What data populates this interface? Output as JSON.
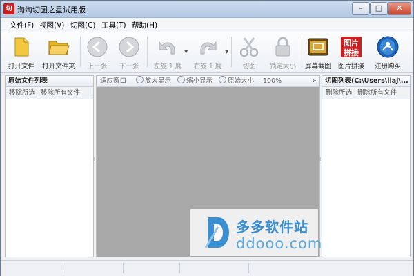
{
  "window": {
    "title": "淘淘切图之星试用版",
    "icon_name": "app-icon",
    "controls": [
      {
        "name": "minimize-button",
        "glyph": "–"
      },
      {
        "name": "maximize-button",
        "glyph": "□"
      },
      {
        "name": "close-button",
        "glyph": "✕"
      }
    ]
  },
  "menu": [
    "文件(F)",
    "视图(V)",
    "切图(C)",
    "工具(T)",
    "帮助(H)"
  ],
  "toolbar": [
    {
      "label": "打开文件",
      "icon": "open-file-icon",
      "enabled": true
    },
    {
      "label": "打开文件夹",
      "icon": "open-folder-icon",
      "enabled": true
    },
    {
      "label": "上一张",
      "icon": "previous-icon",
      "enabled": false
    },
    {
      "label": "下一张",
      "icon": "next-icon",
      "enabled": false
    },
    {
      "label": "左旋 1 度",
      "icon": "rotate-left-icon",
      "enabled": false
    },
    {
      "label": "右旋 1 度",
      "icon": "rotate-right-icon",
      "enabled": false
    },
    {
      "label": "切图",
      "icon": "scissors-icon",
      "enabled": false
    },
    {
      "label": "锁定大小",
      "icon": "lock-icon",
      "enabled": false
    },
    {
      "label": "屏幕截图",
      "icon": "screenshot-icon",
      "enabled": true
    },
    {
      "label": "图片拼接",
      "icon": "image-stitch-icon",
      "enabled": true,
      "icon_text": [
        "图片",
        "拼接"
      ]
    },
    {
      "label": "注册购买",
      "icon": "register-buy-icon",
      "enabled": true
    }
  ],
  "left_panel": {
    "title": "原始文件列表",
    "actions": [
      "移除所选",
      "移除所有文件"
    ]
  },
  "viewer": {
    "fit_label": "适应窗口",
    "zoom_in_label": "放大显示",
    "zoom_out_label": "缩小显示",
    "original_label": "原始大小",
    "zoom_level": "100%",
    "more_glyph": "»"
  },
  "right_panel": {
    "title": "切图列表(C:\\Users\\liaj\\...",
    "actions": [
      "删除所选",
      "删除所有文件"
    ]
  },
  "watermark": {
    "name": "多多软件站",
    "domain": "ddooo.com"
  },
  "colors": {
    "canvas_gray": "#a8a8a8",
    "accent_blue": "#3a8fd3",
    "folder_yellow": "#f2c233"
  }
}
